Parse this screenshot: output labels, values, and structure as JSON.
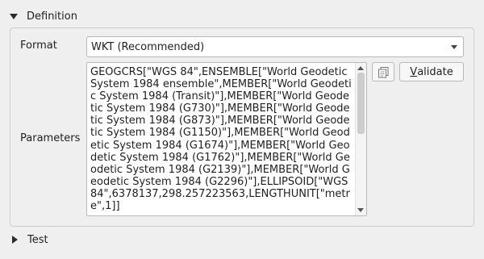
{
  "definition_section": {
    "title": "Definition",
    "expanded": true
  },
  "format": {
    "label": "Format",
    "selected": "WKT (Recommended)"
  },
  "parameters": {
    "label": "Parameters",
    "text": "GEOGCRS[\"WGS 84\",ENSEMBLE[\"World Geodetic System 1984 ensemble\",MEMBER[\"World Geodetic System 1984 (Transit)\"],MEMBER[\"World Geodetic System 1984 (G730)\"],MEMBER[\"World Geodetic System 1984 (G873)\"],MEMBER[\"World Geodetic System 1984 (G1150)\"],MEMBER[\"World Geodetic System 1984 (G1674)\"],MEMBER[\"World Geodetic System 1984 (G1762)\"],MEMBER[\"World Geodetic System 1984 (G2139)\"],MEMBER[\"World Geodetic System 1984 (G2296)\"],ELLIPSOID[\"WGS 84\",6378137,298.257223563,LENGTHUNIT[\"metre\",1]]"
  },
  "buttons": {
    "copy_icon": "copy-icon",
    "validate_mnemonic": "V",
    "validate_rest": "alidate"
  },
  "test_section": {
    "title": "Test",
    "expanded": false
  }
}
